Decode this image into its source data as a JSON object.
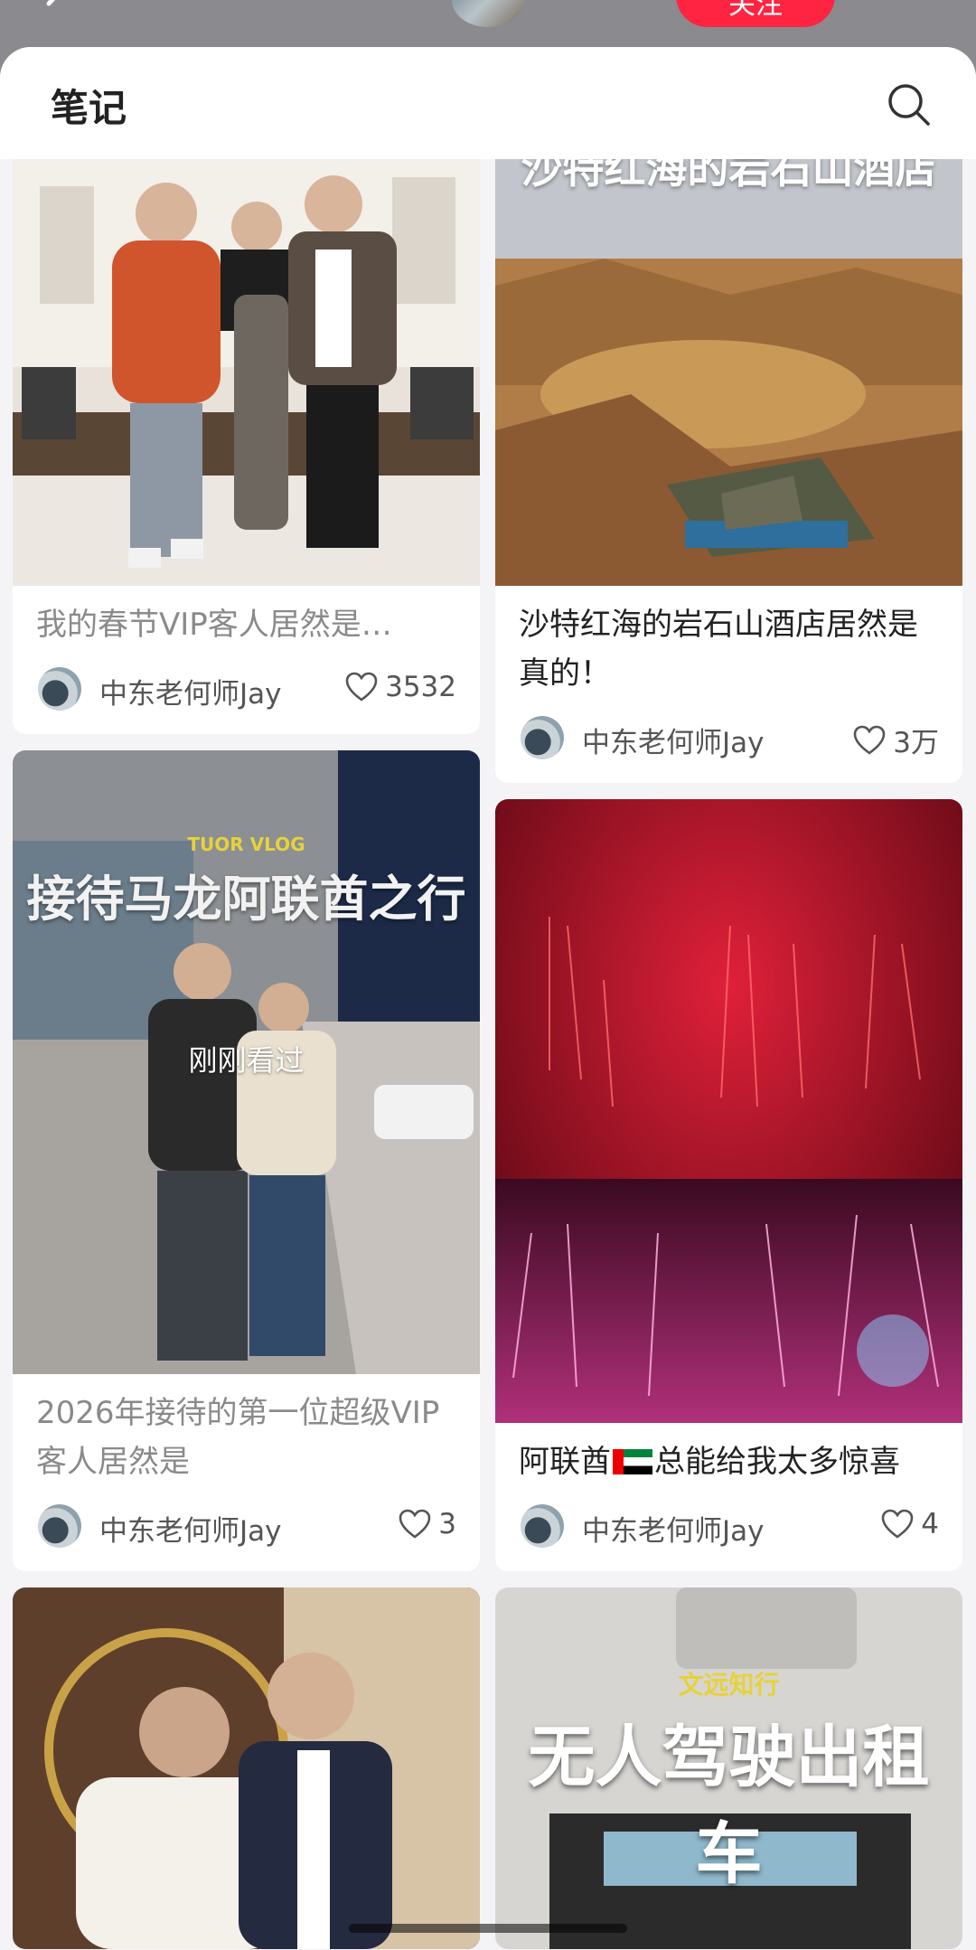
{
  "top": {
    "follow_label": "关注"
  },
  "header": {
    "title": "笔记"
  },
  "cards": {
    "c1": {
      "title": "我的春节VIP客人居然是…",
      "author": "中东老何师Jay",
      "likes": "3532"
    },
    "c2": {
      "title": "沙特红海的岩石山酒店居然是真的！",
      "author": "中东老何师Jay",
      "likes": "3万",
      "cover_text": "沙特红海的岩石山酒店"
    },
    "c3": {
      "title": "2026年接待的第一位超级VIP客人居然是",
      "author": "中东老何师Jay",
      "likes": "3",
      "cover_text": "接待马龙阿联酋之行",
      "cover_subtext": "TUOR VLOG",
      "seen_tag": "刚刚看过"
    },
    "c4": {
      "title_a": "阿联酋",
      "title_b": "总能给我太多惊喜",
      "author": "中东老何师Jay",
      "likes": "4"
    },
    "c6": {
      "cover_text": "无人驾驶出租车",
      "cover_subtext": "文远知行"
    }
  },
  "colors": {
    "accent": "#ff2442",
    "page_bg": "#f4f4f6",
    "overlay_yellow": "#e6d23a"
  },
  "icons": [
    "back-icon",
    "search-icon",
    "heart-icon",
    "uae-flag-icon"
  ]
}
